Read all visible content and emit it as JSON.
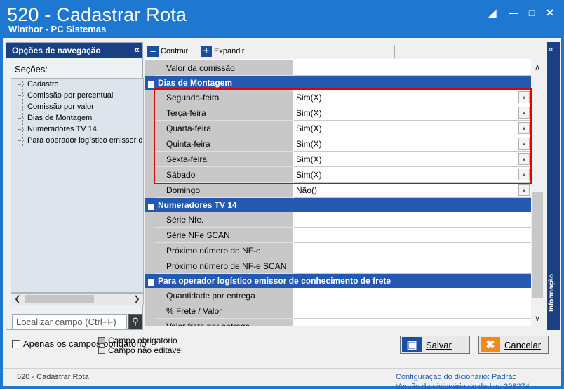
{
  "window": {
    "title": "520 - Cadastrar Rota",
    "subtitle": "Winthor - PC Sistemas"
  },
  "nav": {
    "header": "Opções de navegação",
    "sections_label": "Seções:",
    "items": [
      "Cadastro",
      "Comissão por percentual",
      "Comissão por valor",
      "Dias de Montagem",
      "Numeradores TV 14",
      "Para operador logístico emissor de"
    ],
    "search_placeholder": "Localizar campo (Ctrl+F)",
    "required_only": "Apenas os campos obrigatório"
  },
  "toolbar": {
    "collapse": "Contrair",
    "expand": "Expandir"
  },
  "grid": {
    "row_valor_comissao": {
      "label": "Valor da comissão",
      "value": ""
    },
    "cat_dias": "Dias de Montagem",
    "dias": [
      {
        "label": "Segunda-feira",
        "value": "Sim(X)"
      },
      {
        "label": "Terça-feira",
        "value": "Sim(X)"
      },
      {
        "label": "Quarta-feira",
        "value": "Sim(X)"
      },
      {
        "label": "Quinta-feira",
        "value": "Sim(X)"
      },
      {
        "label": "Sexta-feira",
        "value": "Sim(X)"
      },
      {
        "label": "Sábado",
        "value": "Sim(X)"
      },
      {
        "label": "Domingo",
        "value": "Não()"
      }
    ],
    "cat_numeradores": "Numeradores TV 14",
    "numeradores": [
      {
        "label": "Série Nfe.",
        "value": ""
      },
      {
        "label": "Série NFe SCAN.",
        "value": ""
      },
      {
        "label": "Próximo número de NF-e.",
        "value": ""
      },
      {
        "label": "Próximo número de NF-e SCAN",
        "value": ""
      }
    ],
    "cat_operador": "Para operador logístico emissor de conhecimento de frete",
    "operador": [
      {
        "label": "Quantidade por entrega",
        "value": ""
      },
      {
        "label": "% Frete / Valor",
        "value": ""
      },
      {
        "label": "Valor frete por entrega",
        "value": ""
      }
    ]
  },
  "info_tab": "Informação",
  "legend": {
    "required": "Campo obrigatório",
    "not_editable": "Campo não editável"
  },
  "buttons": {
    "save": "Salvar",
    "cancel": "Cancelar"
  },
  "status": {
    "left": "520 - Cadastrar Rota",
    "config_label": "Configuração do dicionário:",
    "config_value": "Padrão",
    "version_label": "Versão do dicionário de dados:",
    "version_value": "296274"
  },
  "colors": {
    "title_blue": "#1e78d2",
    "category_blue": "#2558b0",
    "highlight_red": "#e00000"
  }
}
